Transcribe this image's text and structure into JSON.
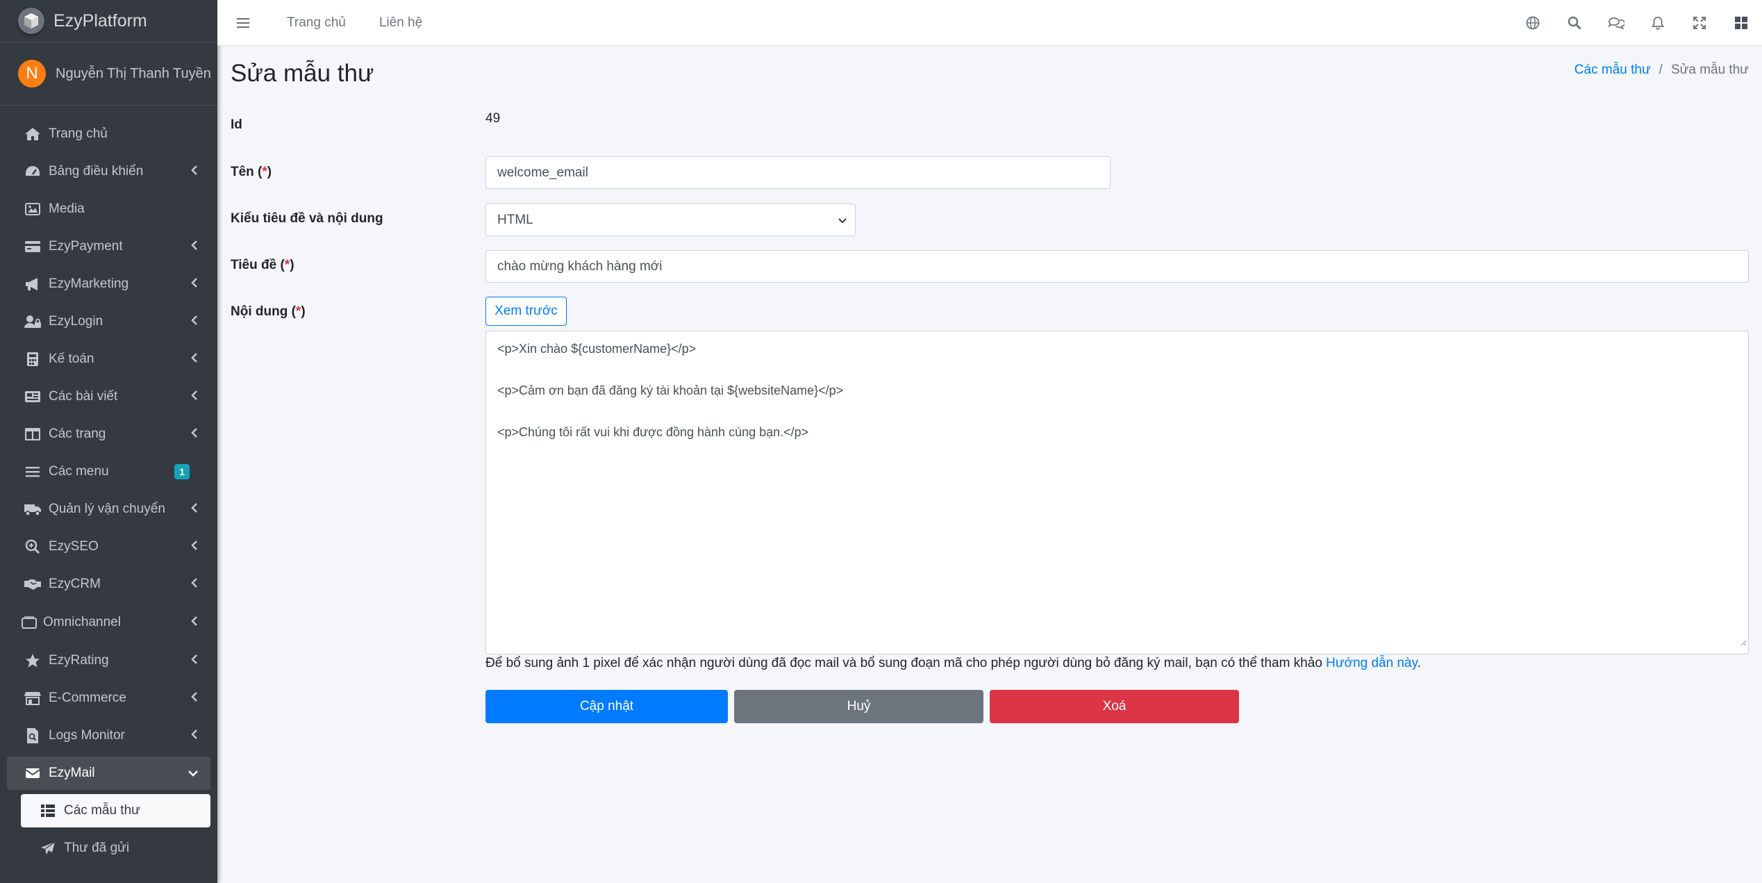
{
  "brand": {
    "name": "EzyPlatform"
  },
  "user": {
    "initial": "N",
    "name": "Nguyễn Thị Thanh Tuyền"
  },
  "sidebar": {
    "items": [
      {
        "label": "Trang chủ",
        "icon": "home-icon"
      },
      {
        "label": "Bảng điều khiển",
        "icon": "dashboard-icon"
      },
      {
        "label": "Media",
        "icon": "image-icon"
      },
      {
        "label": "EzyPayment",
        "icon": "credit-card-icon"
      },
      {
        "label": "EzyMarketing",
        "icon": "megaphone-icon"
      },
      {
        "label": "EzyLogin",
        "icon": "user-lock-icon"
      },
      {
        "label": "Kế toán",
        "icon": "calculator-icon"
      },
      {
        "label": "Các bài viết",
        "icon": "newspaper-icon"
      },
      {
        "label": "Các trang",
        "icon": "columns-icon"
      },
      {
        "label": "Các menu",
        "icon": "bars-icon",
        "badge": "1"
      },
      {
        "label": "Quản lý vận chuyển",
        "icon": "truck-icon"
      },
      {
        "label": "EzySEO",
        "icon": "search-plus-icon"
      },
      {
        "label": "EzyCRM",
        "icon": "handshake-icon"
      },
      {
        "label": "Omnichannel",
        "icon": "window-icon"
      },
      {
        "label": "EzyRating",
        "icon": "star-icon"
      },
      {
        "label": "E-Commerce",
        "icon": "store-icon"
      },
      {
        "label": "Logs Monitor",
        "icon": "file-search-icon"
      },
      {
        "label": "EzyMail",
        "icon": "envelope-icon"
      },
      {
        "label": "Các mẫu thư",
        "icon": "table-list-icon"
      },
      {
        "label": "Thư đã gửi",
        "icon": "paper-plane-icon"
      }
    ]
  },
  "topbar": {
    "links": [
      "Trang chủ",
      "Liên hệ"
    ]
  },
  "page": {
    "title": "Sửa mẫu thư",
    "breadcrumb": {
      "parent": "Các mẫu thư",
      "separator": "/",
      "current": "Sửa mẫu thư"
    }
  },
  "form": {
    "id_label": "Id",
    "id_value": "49",
    "name_label": "Tên (",
    "required_mark": "*",
    "close_paren": ")",
    "name_value": "welcome_email",
    "type_label": "Kiểu tiêu đề và nội dung",
    "type_value": "HTML",
    "subject_label": "Tiêu đề (",
    "subject_value": "chào mừng khách hàng mới",
    "content_label": "Nội dung (",
    "preview_button": "Xem trước",
    "content_lines": [
      "<p>Xin chào ${customerName}</p>",
      "",
      "<p>Cảm ơn bạn đã đăng ký tài khoản tại ${websiteName}</p>",
      "",
      "<p>Chúng tôi rất vui khi được đồng hành cùng bạn.</p>"
    ],
    "help_text": "Để bổ sung ảnh 1 pixel để xác nhận người dùng đã đọc mail và bổ sung đoạn mã cho phép người dùng bỏ đăng ký mail, bạn có thể tham khảo ",
    "help_link": "Hướng dẫn này",
    "help_end": "."
  },
  "buttons": {
    "update": "Cập nhật",
    "cancel": "Huỷ",
    "delete": "Xoá"
  },
  "colors": {
    "primary": "#007bff",
    "secondary": "#6c757d",
    "danger": "#dc3545",
    "sidebar": "#343a40",
    "badge": "#17a2b8",
    "avatar": "#fd7e14"
  }
}
